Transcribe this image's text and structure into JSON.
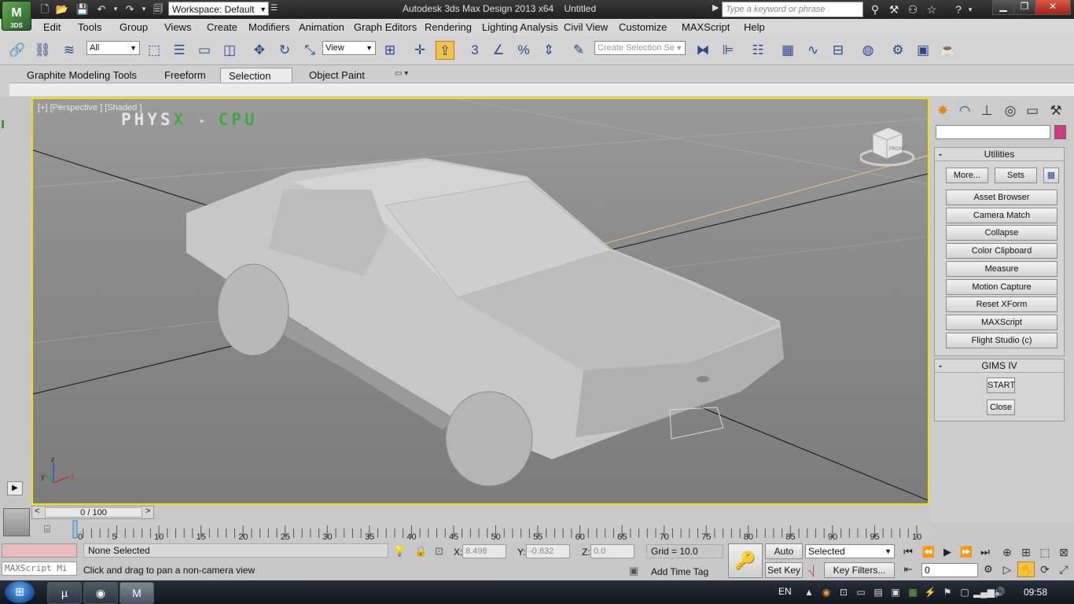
{
  "titlebar": {
    "app_title": "Autodesk 3ds Max Design 2013 x64",
    "doc_title": "Untitled",
    "workspace": "Workspace: Default",
    "search_placeholder": "Type a keyword or phrase",
    "logo_label": "3DS"
  },
  "menus": [
    "Edit",
    "Tools",
    "Group",
    "Views",
    "Create",
    "Modifiers",
    "Animation",
    "Graph Editors",
    "Rendering",
    "Lighting Analysis",
    "Civil View",
    "Customize",
    "MAXScript",
    "Help"
  ],
  "toolbar": {
    "selection_filter": "All",
    "ref_coord": "View",
    "named_selection_placeholder": "Create Selection Se",
    "snap_label": "3"
  },
  "ribbon": {
    "tabs": [
      "Graphite Modeling Tools",
      "Freeform",
      "Selection",
      "Object Paint"
    ],
    "active_tab": "Selection"
  },
  "viewport": {
    "label": "[+] [Perspective ] [Shaded ]",
    "physx_a": "PHYS",
    "physx_x": "X",
    "physx_sep": "▸",
    "physx_cpu": "CPU",
    "navcube_face": "FRONT",
    "axis_x": "x",
    "axis_y": "y",
    "axis_z": "z"
  },
  "command_panel": {
    "utilities": {
      "title": "Utilities",
      "more_label": "More...",
      "sets_label": "Sets",
      "buttons": [
        "Asset Browser",
        "Camera Match",
        "Collapse",
        "Color Clipboard",
        "Measure",
        "Motion Capture",
        "Reset XForm",
        "MAXScript",
        "Flight Studio (c)"
      ]
    },
    "gims": {
      "title": "GIMS IV",
      "start_label": "START",
      "close_label": "Close"
    }
  },
  "timeline": {
    "frame_display": "0 / 100",
    "ticks": [
      "0",
      "5",
      "10",
      "15",
      "20",
      "25",
      "30",
      "35",
      "40",
      "45",
      "50",
      "55",
      "60",
      "65",
      "70",
      "75",
      "80",
      "85",
      "90",
      "95",
      "100"
    ]
  },
  "status": {
    "selection": "None Selected",
    "prompt": "Click and drag to pan a non-camera view",
    "maxscript_placeholder": "MAXScript Mi",
    "x_label": "X:",
    "x_value": "8.498",
    "y_label": "Y:",
    "y_value": "-0.832",
    "z_label": "Z:",
    "z_value": "0.0",
    "grid": "Grid = 10.0",
    "add_time_tag": "Add Time Tag",
    "auto_key": "Auto Key",
    "set_key": "Set Key",
    "key_filters": "Key Filters...",
    "selected_set": "Selected",
    "current_frame": "0"
  },
  "taskbar": {
    "language": "EN",
    "time": "09:58"
  }
}
